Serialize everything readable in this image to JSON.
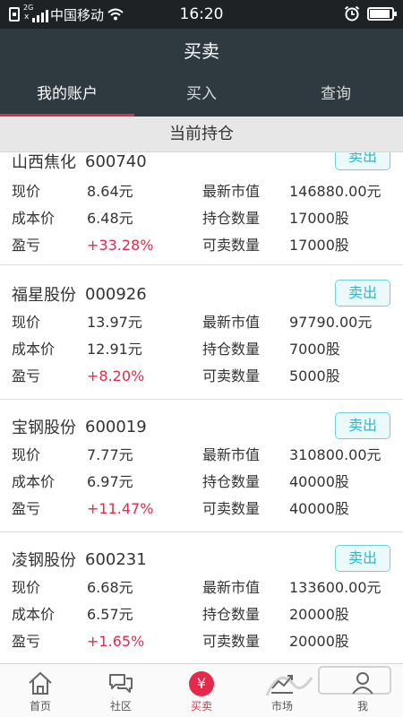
{
  "status_bar": {
    "network_type": "2G",
    "carrier": "中国移动",
    "time": "16:20"
  },
  "header": {
    "title": "买卖"
  },
  "tabs": [
    {
      "label": "我的账户",
      "active": true
    },
    {
      "label": "买入",
      "active": false
    },
    {
      "label": "查询",
      "active": false
    }
  ],
  "section_title": "当前持仓",
  "field_labels": {
    "price": "现价",
    "cost": "成本价",
    "pnl": "盈亏",
    "market_value": "最新市值",
    "holding_qty": "持仓数量",
    "sellable_qty": "可卖数量"
  },
  "sell_button_label": "卖出",
  "holdings": [
    {
      "name": "山西焦化",
      "code": "600740",
      "price": "8.64元",
      "cost": "6.48元",
      "pnl": "+33.28%",
      "market_value": "146880.00元",
      "holding_qty": "17000股",
      "sellable_qty": "17000股"
    },
    {
      "name": "福星股份",
      "code": "000926",
      "price": "13.97元",
      "cost": "12.91元",
      "pnl": "+8.20%",
      "market_value": "97790.00元",
      "holding_qty": "7000股",
      "sellable_qty": "5000股"
    },
    {
      "name": "宝钢股份",
      "code": "600019",
      "price": "7.77元",
      "cost": "6.97元",
      "pnl": "+11.47%",
      "market_value": "310800.00元",
      "holding_qty": "40000股",
      "sellable_qty": "40000股"
    },
    {
      "name": "凌钢股份",
      "code": "600231",
      "price": "6.68元",
      "cost": "6.57元",
      "pnl": "+1.65%",
      "market_value": "133600.00元",
      "holding_qty": "20000股",
      "sellable_qty": "20000股"
    }
  ],
  "bottom_nav": [
    {
      "label": "首页",
      "icon": "home-icon"
    },
    {
      "label": "社区",
      "icon": "chat-icon"
    },
    {
      "label": "买卖",
      "icon": "yuan-icon",
      "active": true,
      "glyph": "¥"
    },
    {
      "label": "市场",
      "icon": "market-icon"
    },
    {
      "label": "我",
      "icon": "user-icon"
    }
  ],
  "colors": {
    "header_bg": "#2f3a40",
    "accent_red": "#e5294a",
    "sell_button": "#31b6c8"
  }
}
